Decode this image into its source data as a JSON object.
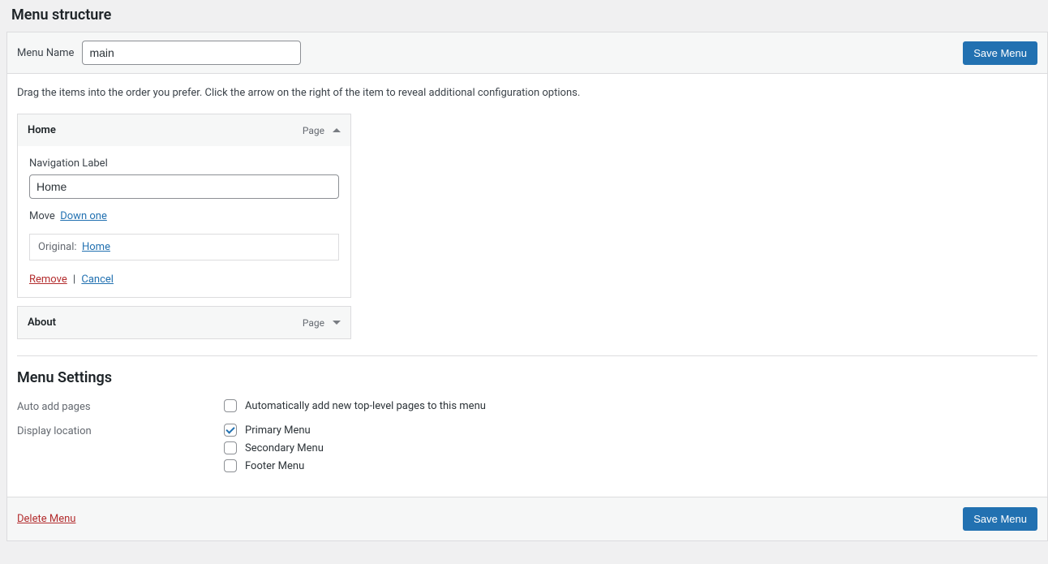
{
  "section_title": "Menu structure",
  "header": {
    "menu_name_label": "Menu Name",
    "menu_name_value": "main",
    "save_button": "Save Menu"
  },
  "instructions": "Drag the items into the order you prefer. Click the arrow on the right of the item to reveal additional configuration options.",
  "items": [
    {
      "title": "Home",
      "type": "Page",
      "expanded": true,
      "nav_label_label": "Navigation Label",
      "nav_label_value": "Home",
      "move_label": "Move",
      "move_down": "Down one",
      "original_label": "Original:",
      "original_link": "Home",
      "remove": "Remove",
      "cancel": "Cancel"
    },
    {
      "title": "About",
      "type": "Page",
      "expanded": false
    }
  ],
  "settings": {
    "title": "Menu Settings",
    "auto_add_label": "Auto add pages",
    "auto_add_option": "Automatically add new top-level pages to this menu",
    "auto_add_checked": false,
    "display_location_label": "Display location",
    "locations": [
      {
        "label": "Primary Menu",
        "checked": true
      },
      {
        "label": "Secondary Menu",
        "checked": false
      },
      {
        "label": "Footer Menu",
        "checked": false
      }
    ]
  },
  "footer": {
    "delete": "Delete Menu",
    "save_button": "Save Menu"
  }
}
